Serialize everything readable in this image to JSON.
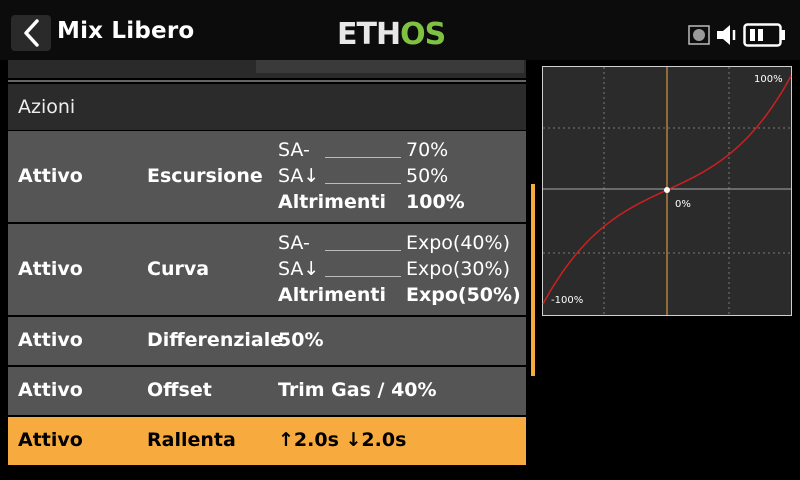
{
  "header": {
    "title": "Mix Libero",
    "logo_text": "ETHOS",
    "logo_colors": {
      "eth": "#e8e8e8",
      "os": "#7fc241"
    },
    "icons": [
      "back-chevron-icon",
      "record-icon",
      "speaker-icon",
      "battery-icon"
    ]
  },
  "section": {
    "label": "Azioni"
  },
  "rows": [
    {
      "status": "Attivo",
      "action": "Escursione",
      "lines": [
        {
          "switch": "SA-",
          "value": "70%"
        },
        {
          "switch": "SA↓",
          "value": "50%"
        },
        {
          "switch": "Altrimenti",
          "value": "100%"
        }
      ]
    },
    {
      "status": "Attivo",
      "action": "Curva",
      "lines": [
        {
          "switch": "SA-",
          "value": "Expo(40%)"
        },
        {
          "switch": "SA↓",
          "value": "Expo(30%)"
        },
        {
          "switch": "Altrimenti",
          "value": "Expo(50%)"
        }
      ]
    },
    {
      "status": "Attivo",
      "action": "Differenziale",
      "value": "50%"
    },
    {
      "status": "Attivo",
      "action": "Offset",
      "value": "Trim Gas / 40%"
    },
    {
      "status": "Attivo",
      "action": "Rallenta",
      "value": "↑2.0s ↓2.0s",
      "selected": true
    }
  ],
  "graph": {
    "label_top": "100%",
    "label_center": "0%",
    "label_bottom": "-100%",
    "curve_color": "#cc2020",
    "axis_color": "#f7ab3f",
    "expo_percent": 50
  },
  "colors": {
    "accent": "#f7ab3f",
    "row_bg": "#555555"
  }
}
